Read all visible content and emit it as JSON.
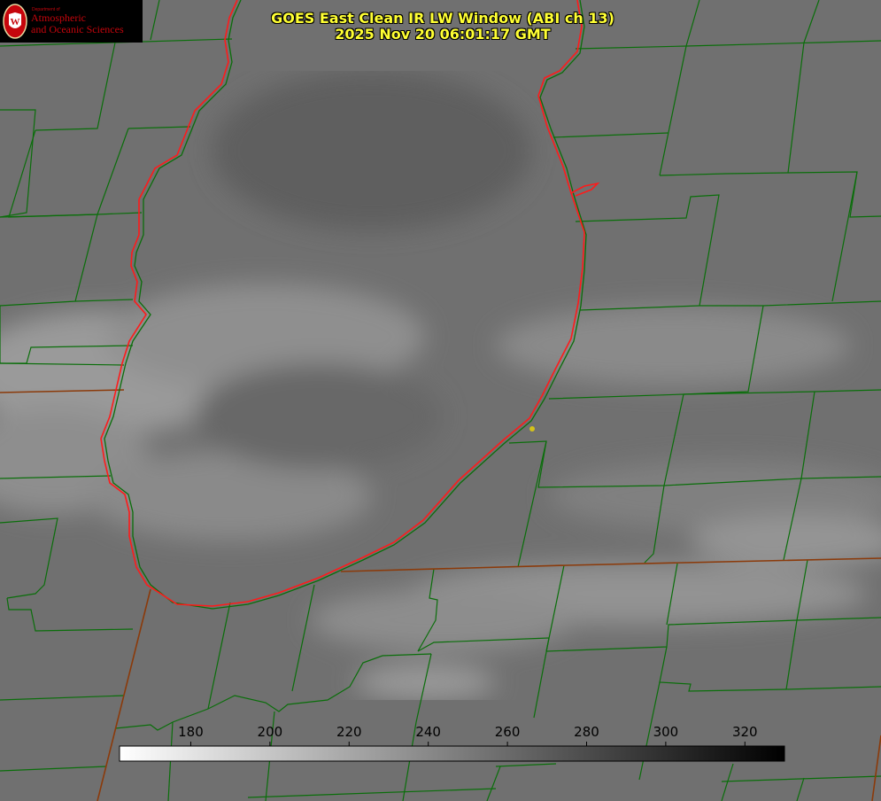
{
  "title": {
    "line1": "GOES East Clean IR LW Window (ABI ch 13)",
    "line2": "2025 Nov 20 06:01:17 GMT"
  },
  "logo": {
    "department": "Department of",
    "name_line1": "Atmospheric",
    "name_line2": "and Oceanic Sciences",
    "seal_letter": "W",
    "icon": "uw-crest-icon"
  },
  "colorbar": {
    "ticks": [
      "180",
      "200",
      "220",
      "240",
      "260",
      "280",
      "300",
      "320"
    ],
    "min": 162,
    "max": 330,
    "gradient_start": "#ffffff",
    "gradient_end": "#000000"
  },
  "colors": {
    "county_lines": "#0a6e0a",
    "state_lines": "#8b3a0a",
    "lake_shore": "#ff1a1a",
    "title_text": "#ffff33",
    "marker": "#d4c21a"
  }
}
